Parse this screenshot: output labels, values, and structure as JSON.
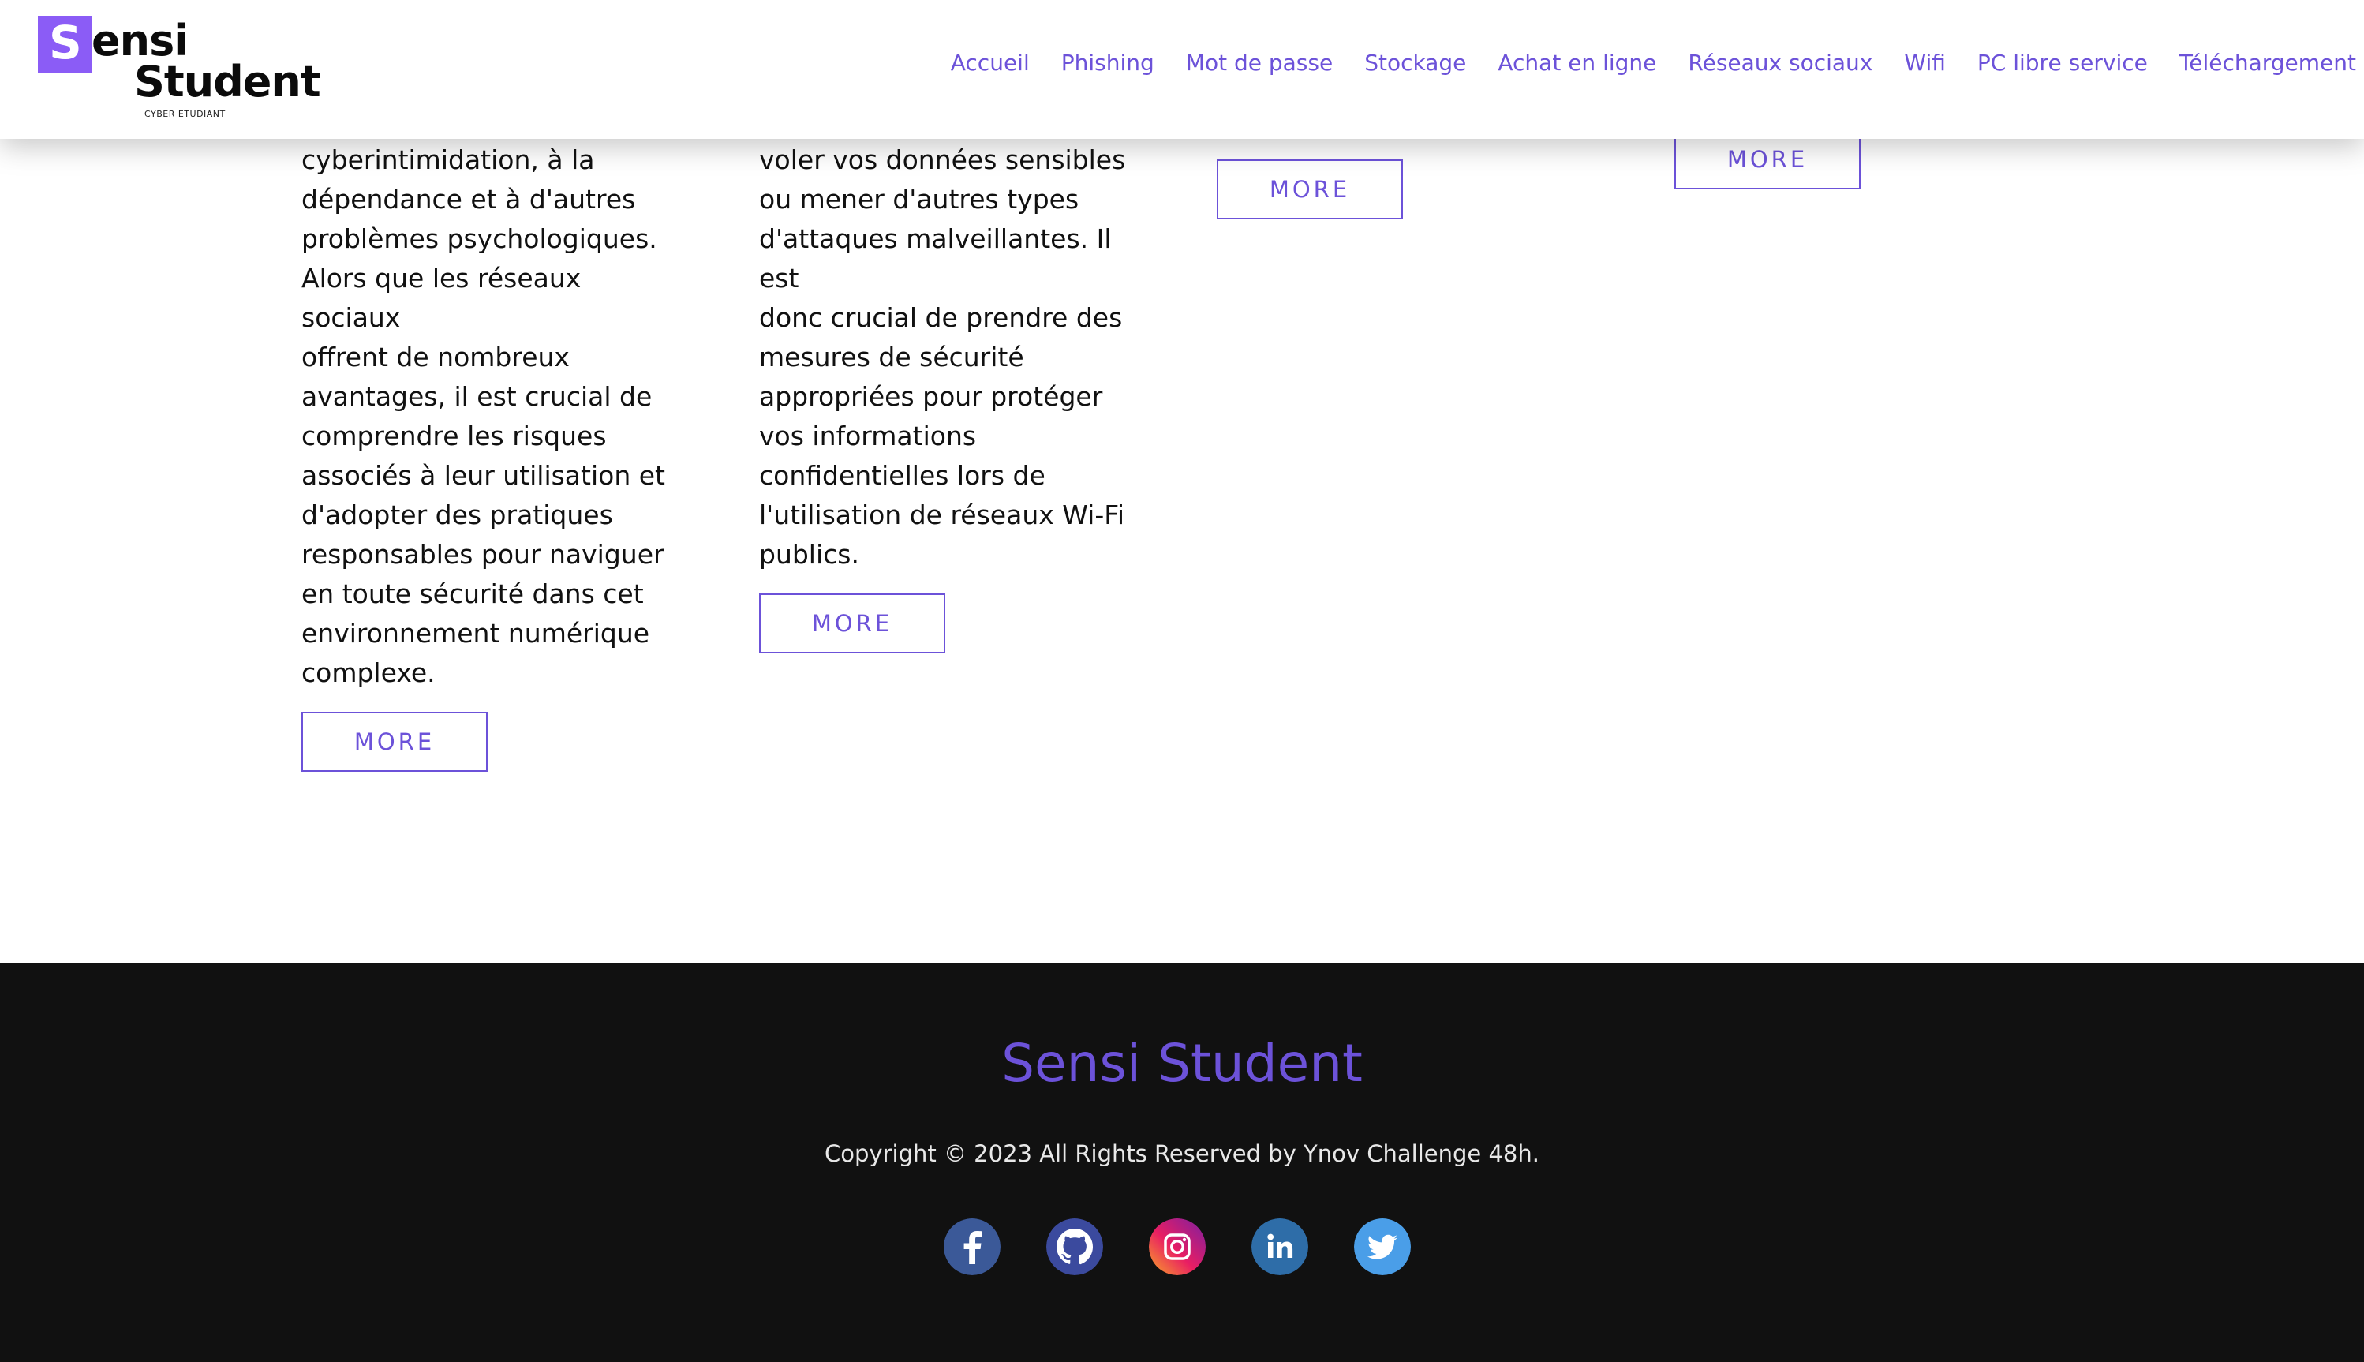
{
  "header": {
    "logo": {
      "letter": "S",
      "line1": "ensi",
      "line2": "Student",
      "tagline": "CYBER ETUDIANT"
    },
    "nav": [
      {
        "label": "Accueil"
      },
      {
        "label": "Phishing"
      },
      {
        "label": "Mot de passe"
      },
      {
        "label": "Stockage"
      },
      {
        "label": "Achat en ligne"
      },
      {
        "label": "Réseaux sociaux"
      },
      {
        "label": "Wifi"
      },
      {
        "label": "PC libre service"
      },
      {
        "label": "Téléchargement"
      }
    ]
  },
  "main": {
    "columns": [
      {
        "lines": [
          "cyberintimidation, à la",
          "dépendance et à d'autres",
          "problèmes psychologiques.",
          "Alors que les réseaux sociaux",
          "offrent de nombreux",
          "avantages, il est crucial de",
          "comprendre les risques",
          "associés à leur utilisation et",
          "d'adopter des pratiques",
          "responsables pour naviguer",
          "en toute sécurité dans cet",
          "environnement numérique",
          "complexe."
        ],
        "button": "MORE"
      },
      {
        "lines": [
          "voler vos données sensibles",
          "ou mener d'autres types",
          "d'attaques malveillantes. Il est",
          "donc crucial de prendre des",
          "mesures de sécurité",
          "appropriées pour protéger",
          "vos informations",
          "confidentielles lors de",
          "l'utilisation de réseaux Wi-Fi",
          "publics."
        ],
        "button": "MORE"
      },
      {
        "lines": [],
        "button": "MORE"
      },
      {
        "lines": [],
        "button": "MORE"
      }
    ]
  },
  "footer": {
    "title": "Sensi Student",
    "copyright": "Copyright © 2023 All Rights Reserved by Ynov Challenge 48h.",
    "socials": [
      {
        "icon": "facebook-icon"
      },
      {
        "icon": "github-icon"
      },
      {
        "icon": "instagram-icon"
      },
      {
        "icon": "linkedin-icon"
      },
      {
        "icon": "twitter-icon"
      }
    ]
  },
  "colors": {
    "accent": "#6c52d9",
    "logo_square": "#8b5cf6",
    "footer_bg": "#111111",
    "text": "#111111"
  }
}
